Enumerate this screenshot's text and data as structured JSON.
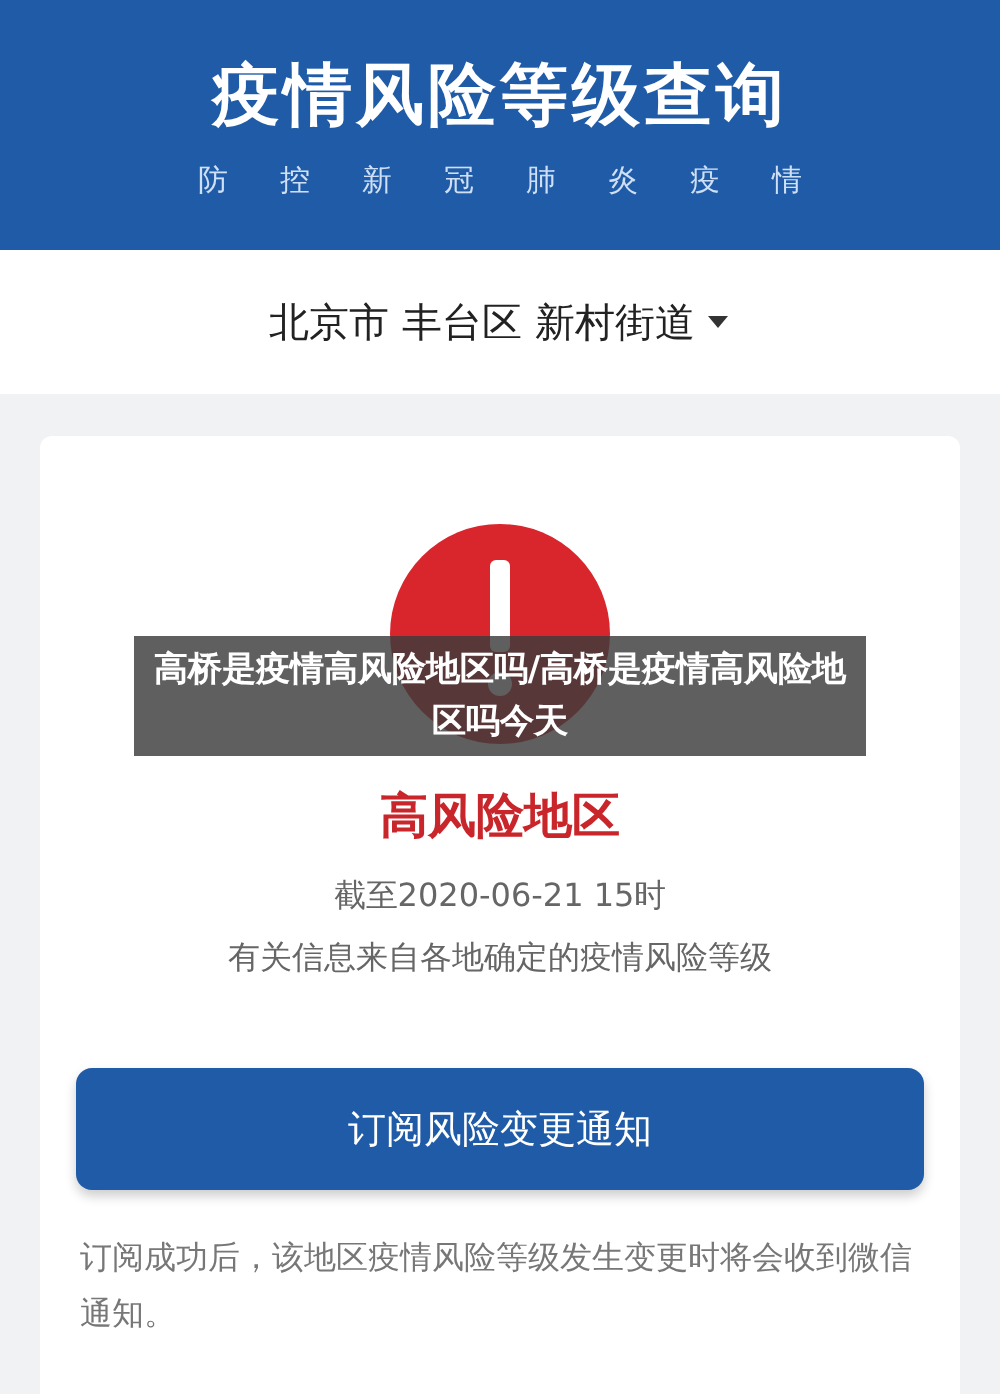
{
  "header": {
    "title": "疫情风险等级查询",
    "subtitle": [
      "防",
      "控",
      "新",
      "冠",
      "肺",
      "炎",
      "疫",
      "情"
    ]
  },
  "location": {
    "value": "北京市 丰台区 新村街道"
  },
  "result": {
    "level": "高风险地区",
    "as_of": "截至2020-06-21 15时",
    "source": "有关信息来自各地确定的疫情风险等级"
  },
  "subscribe_button": "订阅风险变更通知",
  "note": "订阅成功后，该地区疫情风险等级发生变更时将会收到微信通知。",
  "overlay_caption": "高桥是疫情高风险地区吗/高桥是疫情高风险地区吗今天"
}
